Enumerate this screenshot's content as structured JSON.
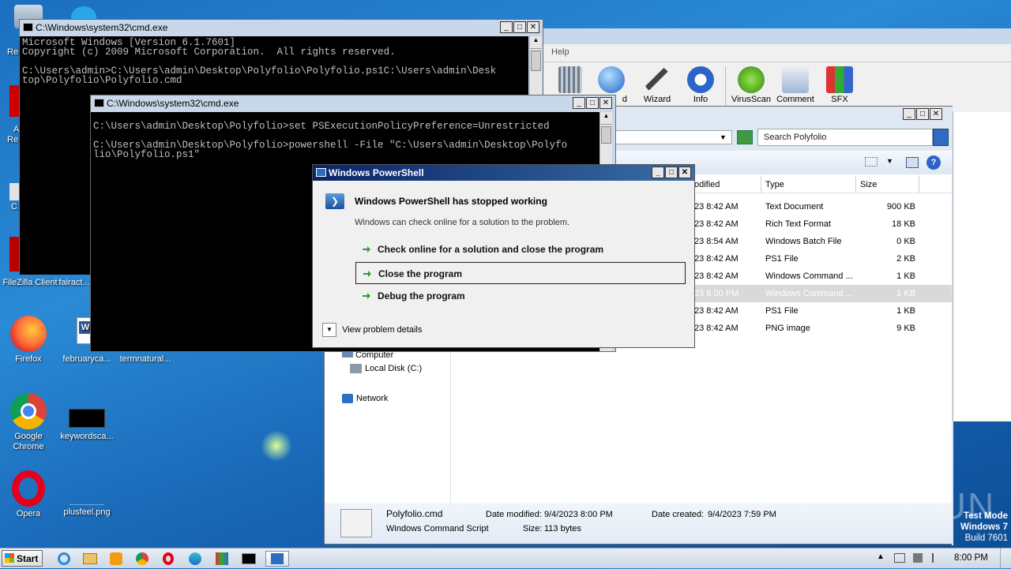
{
  "desktop": {
    "icons": [
      {
        "label": "FileZilla Client",
        "icon": "filezilla-icon"
      },
      {
        "label": "fairact...",
        "icon": "file-icon"
      },
      {
        "label": "Firefox",
        "icon": "firefox-icon"
      },
      {
        "label": "februaryca...",
        "icon": "word-doc-icon"
      },
      {
        "label": "termnatural...",
        "icon": "file-icon"
      },
      {
        "label": "Google Chrome",
        "icon": "chrome-icon"
      },
      {
        "label": "keywordsca...",
        "icon": "black-file-icon"
      },
      {
        "label": "Opera",
        "icon": "opera-icon"
      },
      {
        "label": "plusfeel.png",
        "icon": "image-file-icon"
      }
    ],
    "left_fragments": [
      "Re",
      "A",
      "Re",
      "C"
    ],
    "watermark": "ANY RUN",
    "test_mode": {
      "line1": "Test Mode",
      "line2": "Windows 7",
      "line3": "Build 7601"
    }
  },
  "cmd1": {
    "title": "C:\\Windows\\system32\\cmd.exe",
    "lines": [
      "Microsoft Windows [Version 6.1.7601]",
      "Copyright (c) 2009 Microsoft Corporation.  All rights reserved.",
      "",
      "C:\\Users\\admin>C:\\Users\\admin\\Desktop\\Polyfolio\\Polyfolio.ps1C:\\Users\\admin\\Desk",
      "top\\Polyfolio\\Polyfolio.cmd"
    ]
  },
  "cmd2": {
    "title": "C:\\Windows\\system32\\cmd.exe",
    "lines": [
      "C:\\Users\\admin\\Desktop\\Polyfolio>set PSExecutionPolicyPreference=Unrestricted",
      "",
      "C:\\Users\\admin\\Desktop\\Polyfolio>powershell -File \"C:\\Users\\admin\\Desktop\\Polyfo",
      "lio\\Polyfolio.ps1\""
    ]
  },
  "winrar": {
    "menu_help": "Help",
    "toolbar": [
      {
        "label": "",
        "icon": "delete-icon"
      },
      {
        "label": "d",
        "icon": "find-icon"
      },
      {
        "label": "Wizard",
        "icon": "wizard-icon"
      },
      {
        "label": "Info",
        "icon": "info-icon"
      },
      {
        "label": "VirusScan",
        "icon": "virusscan-icon"
      },
      {
        "label": "Comment",
        "icon": "comment-icon"
      },
      {
        "label": "SFX",
        "icon": "sfx-icon"
      }
    ]
  },
  "explorer": {
    "search_placeholder": "Search Polyfolio",
    "columns": {
      "modified": "odified",
      "type": "Type",
      "size": "Size"
    },
    "rows": [
      {
        "date": "23 8:42 AM",
        "type": "Text Document",
        "size": "900 KB"
      },
      {
        "date": "23 8:42 AM",
        "type": "Rich Text Format",
        "size": "18 KB"
      },
      {
        "date": "23 8:54 AM",
        "type": "Windows Batch File",
        "size": "0 KB"
      },
      {
        "date": "23 8:42 AM",
        "type": "PS1 File",
        "size": "2 KB"
      },
      {
        "date": "23 8:42 AM",
        "type": "Windows Command ...",
        "size": "1 KB"
      },
      {
        "date": "23 8:00 PM",
        "type": "Windows Command ...",
        "size": "1 KB"
      },
      {
        "date": "23 8:42 AM",
        "type": "PS1 File",
        "size": "1 KB"
      },
      {
        "date": "23 8:42 AM",
        "type": "PNG image",
        "size": "9 KB"
      }
    ],
    "nav": {
      "computer": "Computer",
      "local_disk": "Local Disk (C:)",
      "network": "Network"
    },
    "details": {
      "filename": "Polyfolio.cmd",
      "filetype": "Windows Command Script",
      "modified_label": "Date modified:",
      "modified_value": "9/4/2023 8:00 PM",
      "created_label": "Date created:",
      "created_value": "9/4/2023 7:59 PM",
      "size_label": "Size:",
      "size_value": "113 bytes"
    }
  },
  "dialog": {
    "title": "Windows PowerShell",
    "heading": "Windows PowerShell has stopped working",
    "subtext": "Windows can check online for a solution to the problem.",
    "options": [
      "Check online for a solution and close the program",
      "Close the program",
      "Debug the program"
    ],
    "details_label": "View problem details"
  },
  "taskbar": {
    "start_label": "Start",
    "clock": "8:00 PM"
  }
}
